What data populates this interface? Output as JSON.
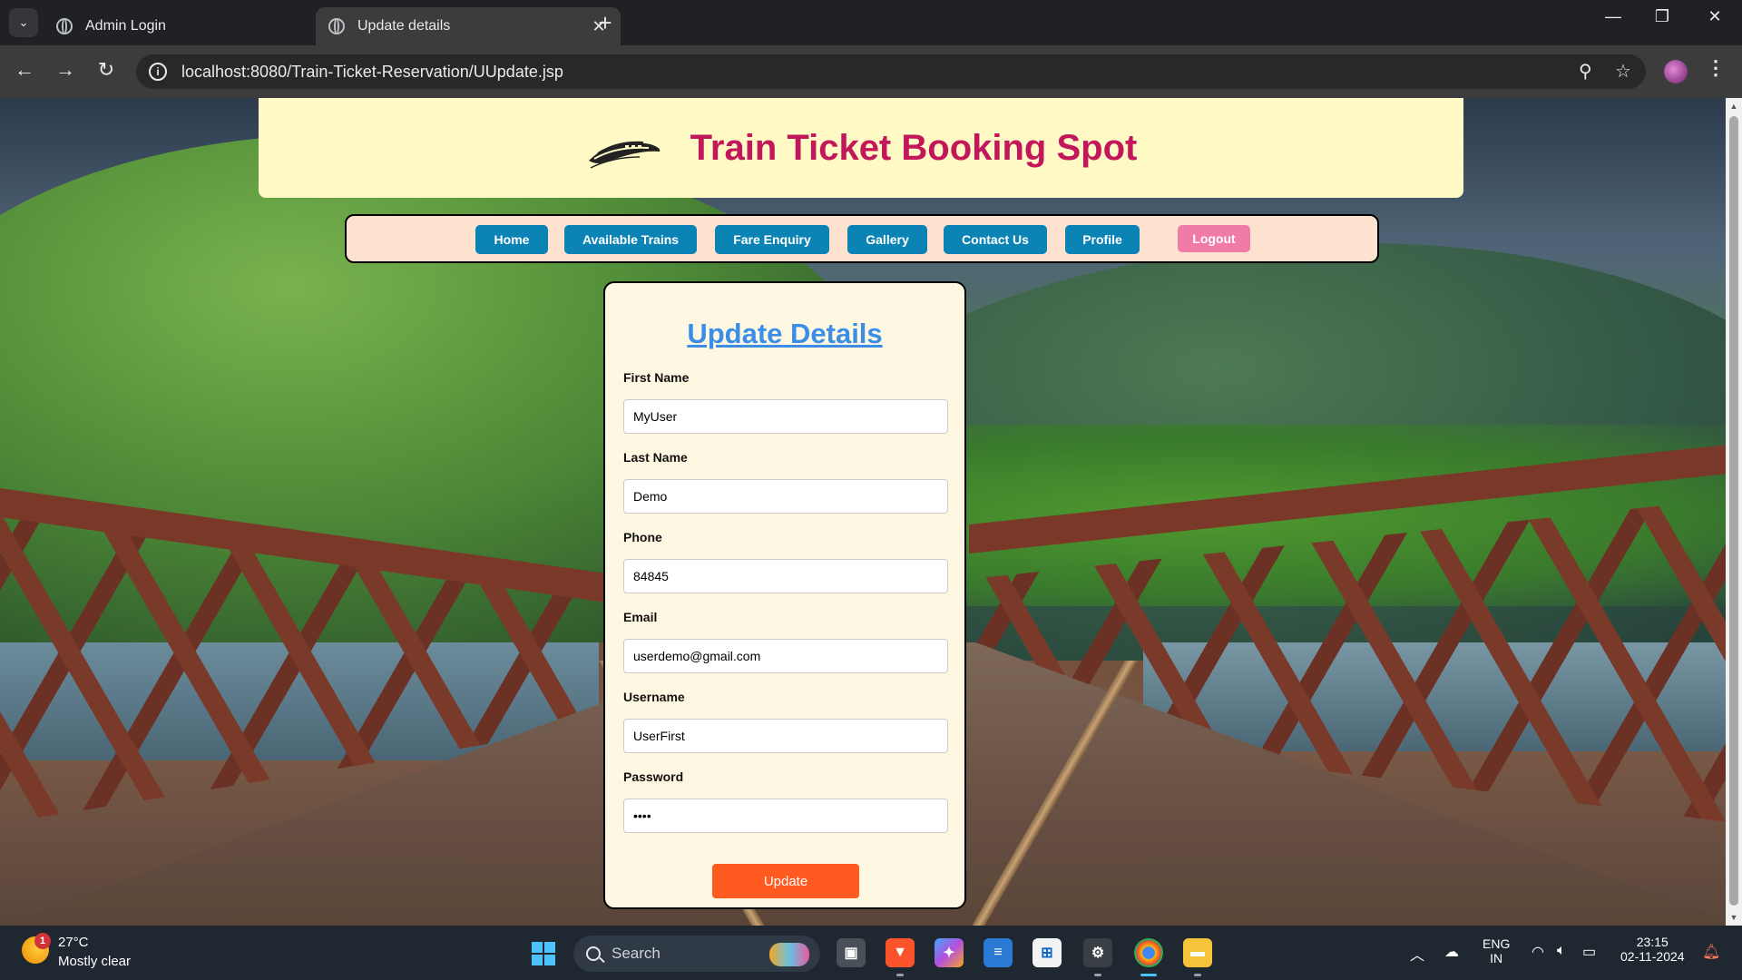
{
  "browser": {
    "tabs": [
      {
        "title": "Admin Login",
        "active": false
      },
      {
        "title": "Update details",
        "active": true
      }
    ],
    "url": "localhost:8080/Train-Ticket-Reservation/UUpdate.jsp"
  },
  "header": {
    "title": "Train Ticket Booking Spot",
    "logo_icon": "train-logo-icon",
    "background": "#fff9c6",
    "title_color": "#c2185b"
  },
  "nav": {
    "items": [
      {
        "label": "Home"
      },
      {
        "label": "Available Trains"
      },
      {
        "label": "Fare Enquiry"
      },
      {
        "label": "Gallery"
      },
      {
        "label": "Contact Us"
      },
      {
        "label": "Profile"
      },
      {
        "label": "Logout"
      }
    ],
    "button_color": "#0b84b5",
    "logout_color": "#f07aa8"
  },
  "form": {
    "title": "Update Details",
    "fields": [
      {
        "label": "First Name",
        "value": "MyUser"
      },
      {
        "label": "Last Name",
        "value": "Demo"
      },
      {
        "label": "Phone",
        "value": "84845"
      },
      {
        "label": "Email",
        "value": "userdemo@gmail.com"
      },
      {
        "label": "Username",
        "value": "UserFirst"
      },
      {
        "label": "Password",
        "value": "••••"
      }
    ],
    "submit_label": "Update",
    "submit_color": "#ff5a1f"
  },
  "taskbar": {
    "weather": {
      "temp": "27°C",
      "condition": "Mostly clear",
      "badge": "1"
    },
    "search_label": "Search",
    "language": {
      "line1": "ENG",
      "line2": "IN"
    },
    "clock": {
      "time": "23:15",
      "date": "02-11-2024"
    }
  }
}
